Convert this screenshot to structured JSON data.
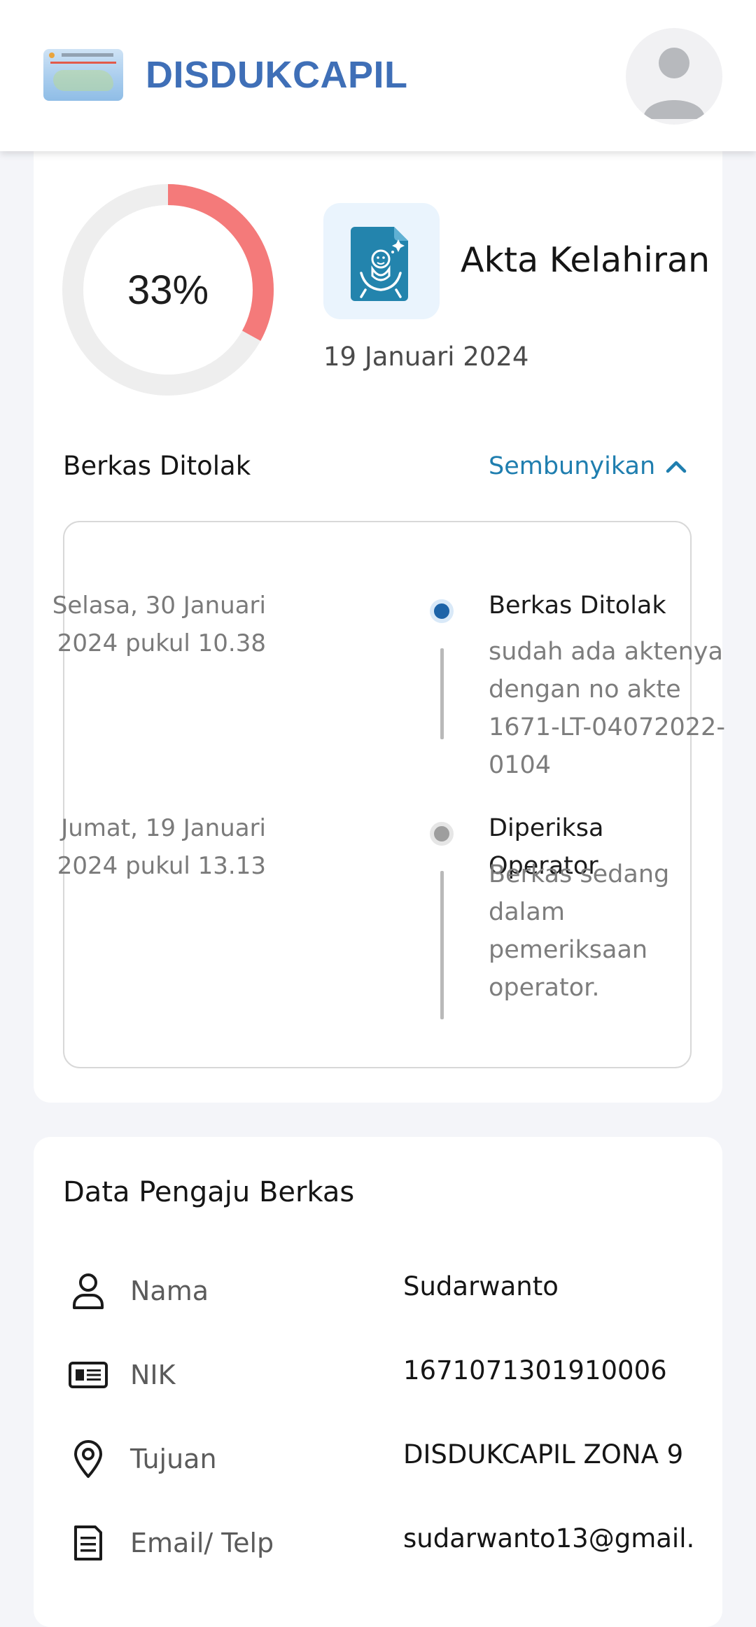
{
  "header": {
    "brand": "DISDUKCAPIL",
    "colors": {
      "brand": "#3f6fb7",
      "background": "#ffffff"
    }
  },
  "status": {
    "progress_label": "33%",
    "progress_fraction": 0.33,
    "colors": {
      "progress": "#f47a7a",
      "track": "#eeeeee"
    },
    "document_type": "Akta Kelahiran",
    "document_icon": "baby-document-icon",
    "submitted_date": "19 Januari 2024",
    "section_title": "Berkas Ditolak",
    "toggle_label": "Sembunyikan",
    "toggle_icon": "chevron-up-icon"
  },
  "timeline": [
    {
      "date_line1": "Selasa, 30 Januari",
      "date_line2": "2024 pukul 10.38",
      "title": "Berkas Ditolak",
      "description": "sudah ada aktenya dengan no akte 1671-LT-04072022-0104",
      "state": "active"
    },
    {
      "date_line1": "Jumat, 19 Januari",
      "date_line2": "2024 pukul 13.13",
      "title": "Diperiksa Operator",
      "description": "Berkas sedang dalam pemeriksaan operator.",
      "state": "inactive"
    }
  ],
  "applicant": {
    "title": "Data Pengaju Berkas",
    "rows": [
      {
        "icon": "person-icon",
        "label": "Nama",
        "value": "Sudarwanto"
      },
      {
        "icon": "id-card-icon",
        "label": "NIK",
        "value": "1671071301910006"
      },
      {
        "icon": "location-pin-icon",
        "label": "Tujuan",
        "value": "DISDUKCAPIL ZONA 9"
      },
      {
        "icon": "document-list-icon",
        "label": "Email/ Telp",
        "value": "sudarwanto13@gmail."
      }
    ]
  }
}
